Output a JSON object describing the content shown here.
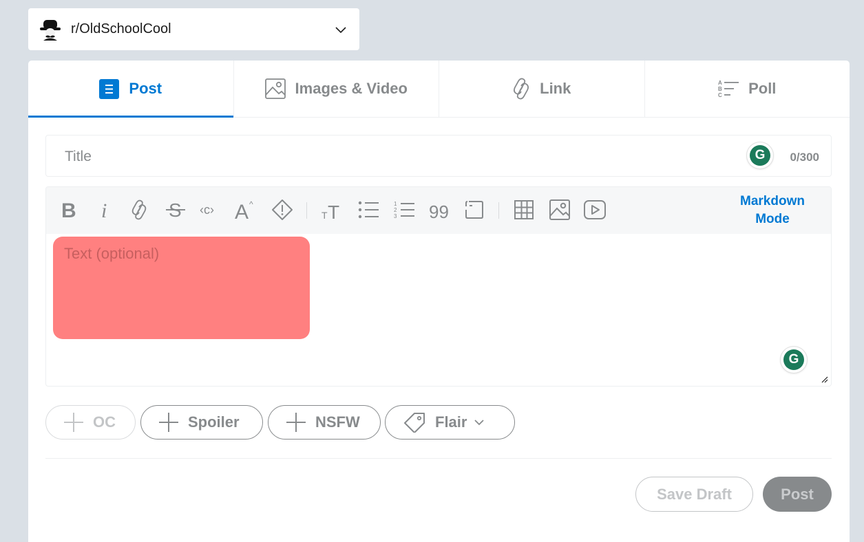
{
  "community": {
    "name": "r/OldSchoolCool"
  },
  "tabs": [
    {
      "label": "Post",
      "active": true,
      "icon": "document-icon"
    },
    {
      "label": "Images & Video",
      "active": false,
      "icon": "image-icon"
    },
    {
      "label": "Link",
      "active": false,
      "icon": "link-icon"
    },
    {
      "label": "Poll",
      "active": false,
      "icon": "poll-icon"
    }
  ],
  "title_field": {
    "placeholder": "Title",
    "value": "",
    "counter": "0/300"
  },
  "toolbar": {
    "buttons": [
      "bold",
      "italic",
      "link",
      "strikethrough",
      "inline-code",
      "superscript",
      "spoiler",
      "heading",
      "bulleted-list",
      "numbered-list",
      "quote-block",
      "code-block",
      "table",
      "image",
      "video"
    ],
    "markdown_mode": "Markdown Mode"
  },
  "body_field": {
    "placeholder": "Text (optional)",
    "value": ""
  },
  "tags": {
    "oc": "OC",
    "spoiler": "Spoiler",
    "nsfw": "NSFW",
    "flair": "Flair"
  },
  "actions": {
    "save_draft": "Save Draft",
    "post": "Post"
  },
  "colors": {
    "accent": "#0079d3",
    "page_bg": "#dae0e6",
    "highlight": "#ff8080",
    "grammarly": "#1b7a5a"
  }
}
